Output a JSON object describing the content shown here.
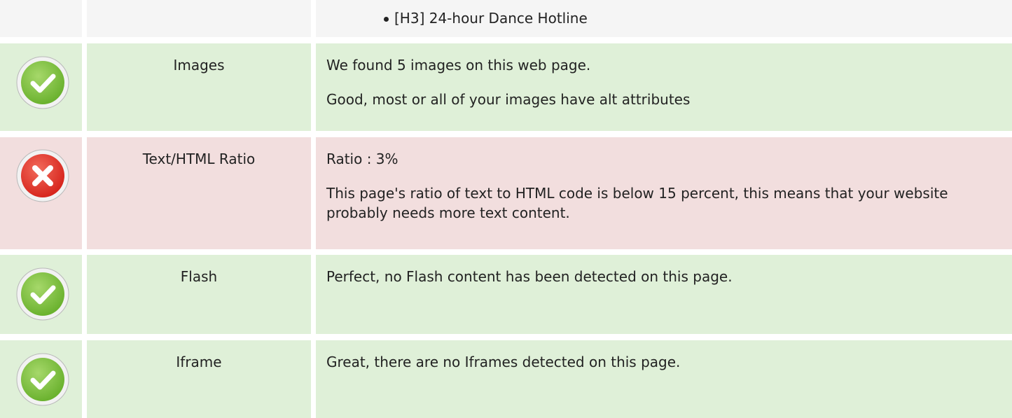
{
  "top_row": {
    "bullet": "[H3] 24-hour Dance Hotline"
  },
  "rows": [
    {
      "status": "pass",
      "icon": "check-icon",
      "label": "Images",
      "lines": [
        "We found 5 images on this web page.",
        "Good, most or all of your images have alt attributes"
      ]
    },
    {
      "status": "fail",
      "icon": "cross-icon",
      "label": "Text/HTML Ratio",
      "lines": [
        "Ratio : 3%",
        "This page's ratio of text to HTML code is below 15 percent, this means that your website probably needs more text content."
      ]
    },
    {
      "status": "pass",
      "icon": "check-icon",
      "label": "Flash",
      "lines": [
        "Perfect, no Flash content has been detected on this page."
      ]
    },
    {
      "status": "pass",
      "icon": "check-icon",
      "label": "Iframe",
      "lines": [
        "Great, there are no Iframes detected on this page."
      ]
    }
  ],
  "colors": {
    "pass_bg": "#dff0d8",
    "fail_bg": "#f2dede",
    "neutral_bg": "#f5f5f5",
    "check_green": "#7dc242",
    "cross_red": "#e53935"
  }
}
